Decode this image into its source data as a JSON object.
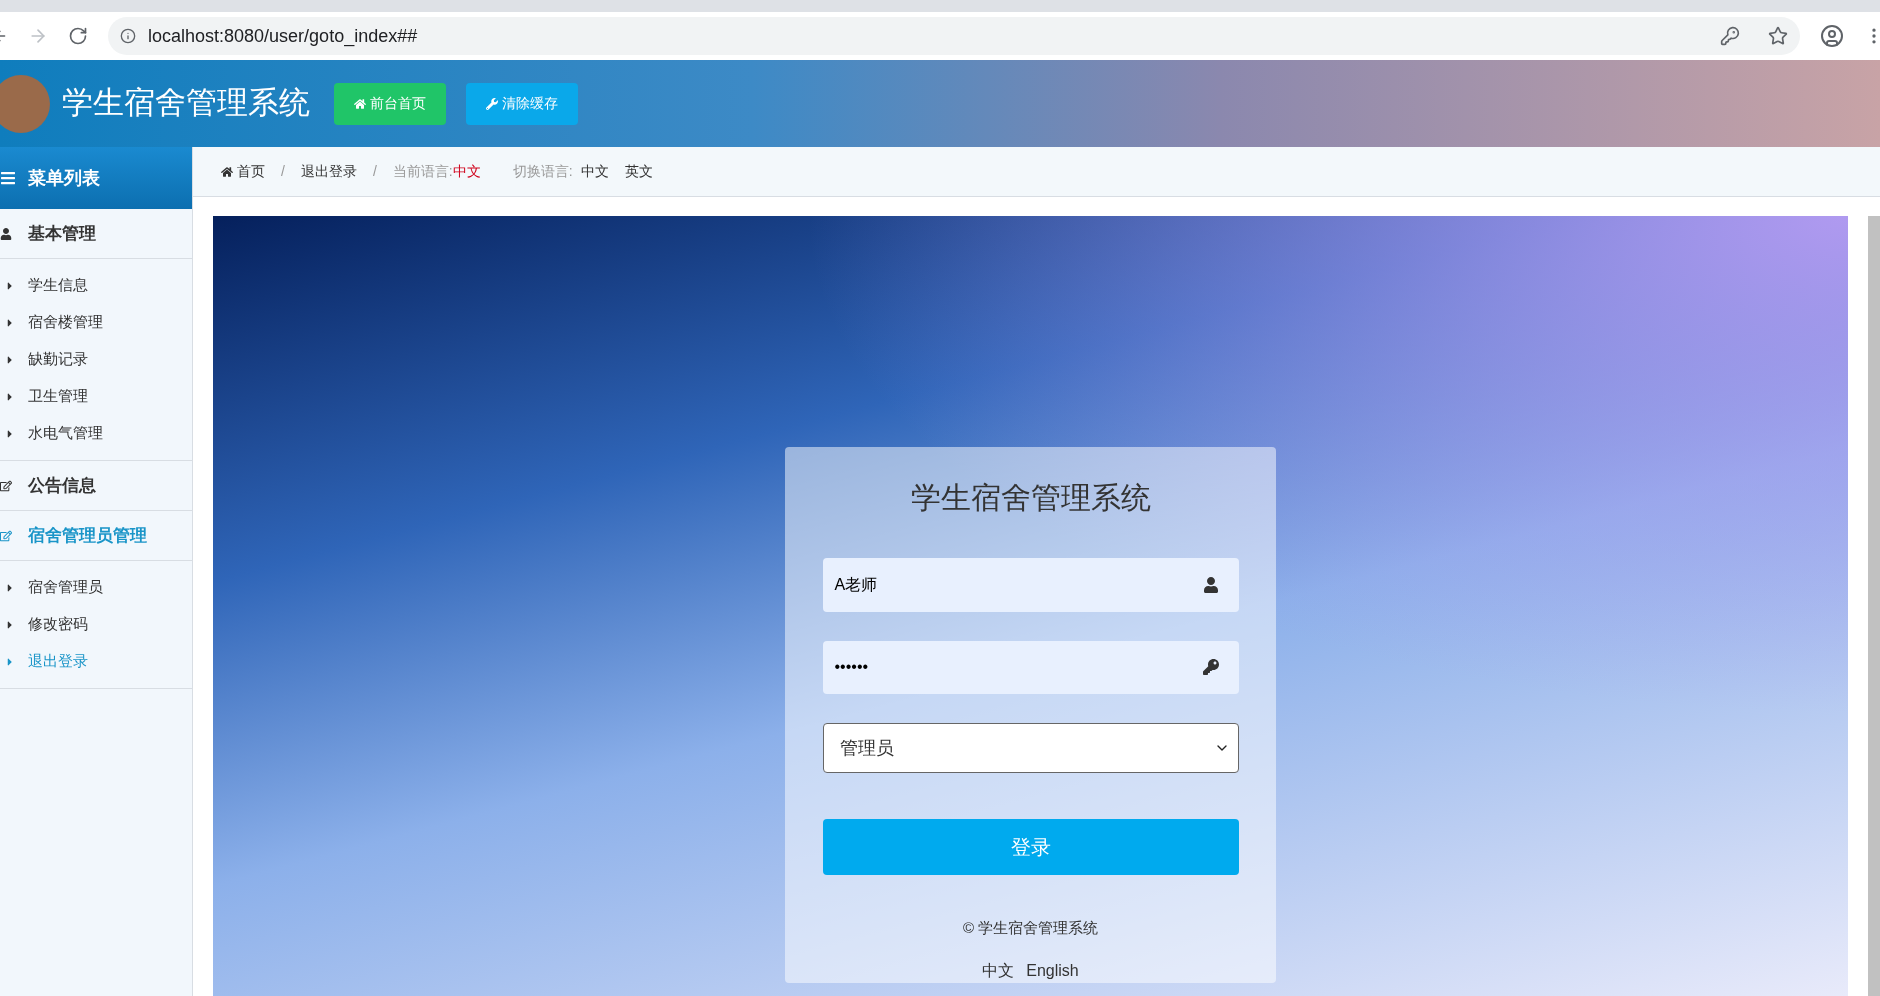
{
  "browser": {
    "url": "localhost:8080/user/goto_index##"
  },
  "header": {
    "title": "学生宿舍管理系统",
    "buttons": [
      {
        "label": "前台首页",
        "kind": "home"
      },
      {
        "label": "清除缓存",
        "kind": "wrench"
      }
    ]
  },
  "sidebar": {
    "title": "菜单列表",
    "sections": [
      {
        "label": "基本管理",
        "kind": "user",
        "selected": false,
        "children": [
          {
            "label": "学生信息",
            "selected": false
          },
          {
            "label": "宿舍楼管理",
            "selected": false
          },
          {
            "label": "缺勤记录",
            "selected": false
          },
          {
            "label": "卫生管理",
            "selected": false
          },
          {
            "label": "水电气管理",
            "selected": false
          }
        ]
      },
      {
        "label": "公告信息",
        "kind": "edit",
        "selected": false
      },
      {
        "label": "宿舍管理员管理",
        "kind": "edit",
        "selected": true,
        "children": [
          {
            "label": "宿舍管理员",
            "selected": false
          },
          {
            "label": "修改密码",
            "selected": false
          },
          {
            "label": "退出登录",
            "selected": true
          }
        ]
      }
    ]
  },
  "breadcrumb": {
    "items": [
      "首页",
      "退出登录"
    ],
    "separators": [
      "/",
      "/"
    ],
    "current_language_label": "当前语言:",
    "current_language": "中文",
    "switch_label": "切换语言:",
    "switch_options": [
      "中文",
      "英文"
    ]
  },
  "login": {
    "title": "学生宿舍管理系统",
    "username": "A老师",
    "password": "••••••",
    "role": "管理员",
    "submit": "登录",
    "copyright": "© 学生宿舍管理系统",
    "languages": [
      "中文",
      "English"
    ]
  }
}
